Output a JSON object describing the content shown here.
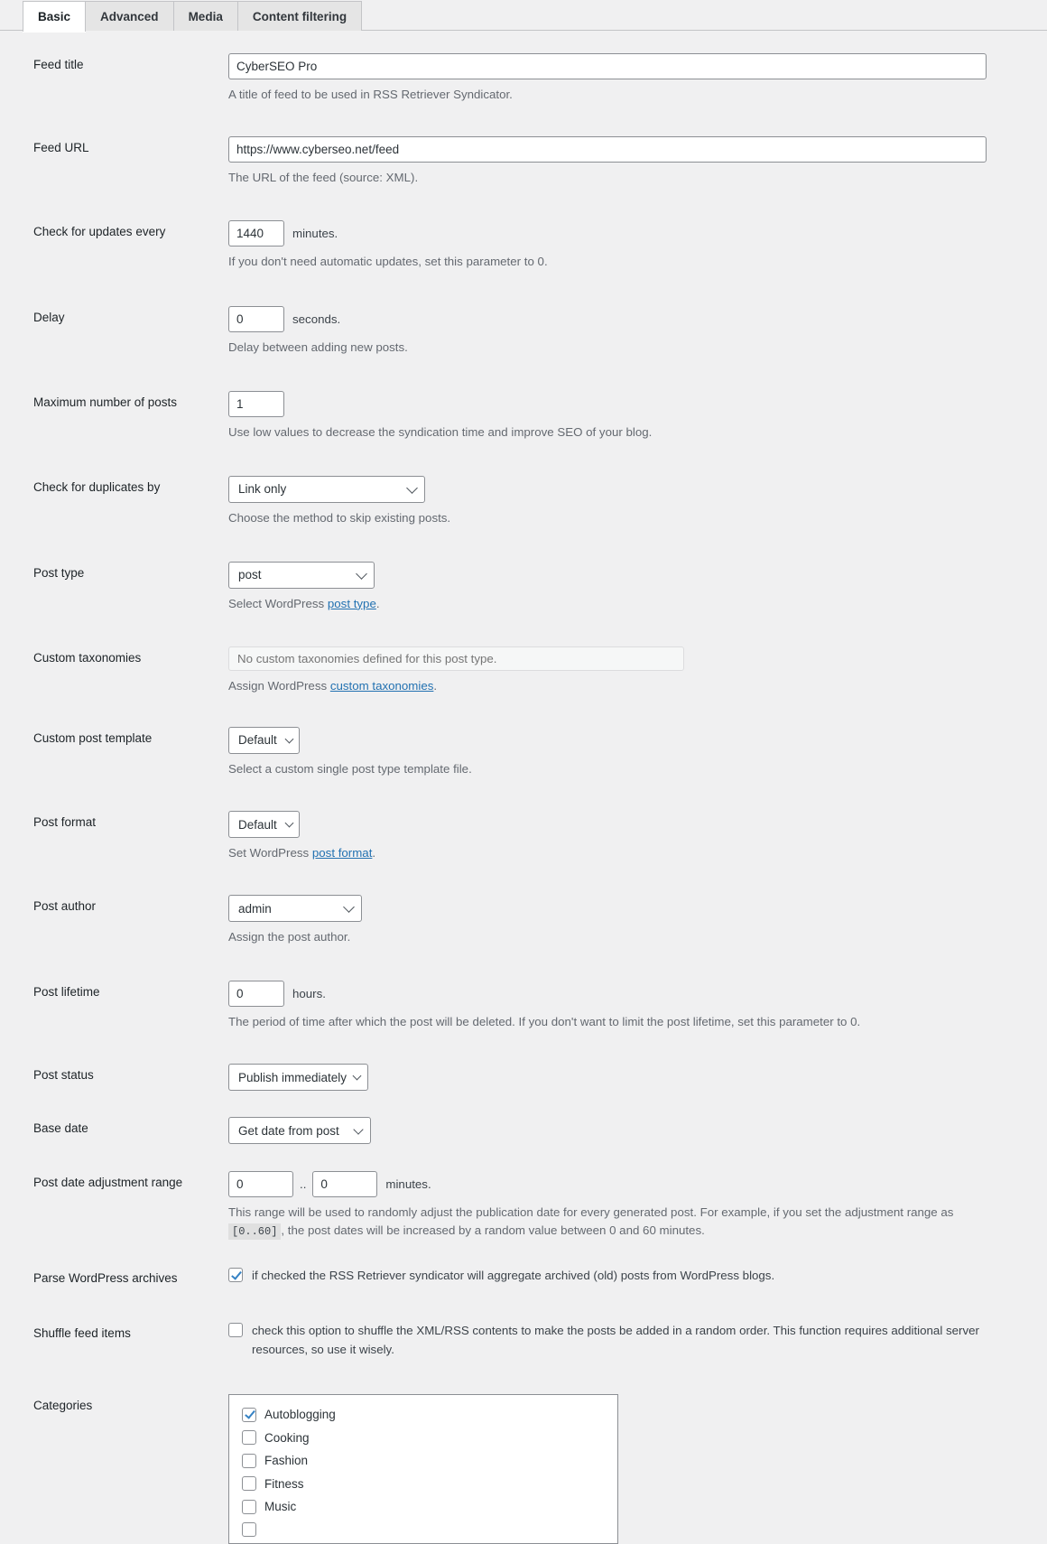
{
  "tabs": [
    {
      "label": "Basic",
      "active": true
    },
    {
      "label": "Advanced",
      "active": false
    },
    {
      "label": "Media",
      "active": false
    },
    {
      "label": "Content filtering",
      "active": false
    }
  ],
  "fields": {
    "feed_title": {
      "label": "Feed title",
      "value": "CyberSEO Pro",
      "description": "A title of feed to be used in RSS Retriever Syndicator."
    },
    "feed_url": {
      "label": "Feed URL",
      "value": "https://www.cyberseo.net/feed",
      "description": "The URL of the feed (source: XML)."
    },
    "check_updates": {
      "label": "Check for updates every",
      "value": "1440",
      "unit": "minutes.",
      "description": "If you don't need automatic updates, set this parameter to 0."
    },
    "delay": {
      "label": "Delay",
      "value": "0",
      "unit": "seconds.",
      "description": "Delay between adding new posts."
    },
    "max_posts": {
      "label": "Maximum number of posts",
      "value": "1",
      "description": "Use low values to decrease the syndication time and improve SEO of your blog."
    },
    "check_duplicates": {
      "label": "Check for duplicates by",
      "value": "Link only",
      "description": "Choose the method to skip existing posts."
    },
    "post_type": {
      "label": "Post type",
      "value": "post",
      "desc_prefix": "Select WordPress ",
      "desc_link": "post type",
      "desc_suffix": "."
    },
    "custom_taxonomies": {
      "label": "Custom taxonomies",
      "placeholder": "No custom taxonomies defined for this post type.",
      "desc_prefix": "Assign WordPress ",
      "desc_link": "custom taxonomies",
      "desc_suffix": "."
    },
    "custom_post_template": {
      "label": "Custom post template",
      "value": "Default",
      "description": "Select a custom single post type template file."
    },
    "post_format": {
      "label": "Post format",
      "value": "Default",
      "desc_prefix": "Set WordPress ",
      "desc_link": "post format",
      "desc_suffix": "."
    },
    "post_author": {
      "label": "Post author",
      "value": "admin",
      "description": "Assign the post author."
    },
    "post_lifetime": {
      "label": "Post lifetime",
      "value": "0",
      "unit": "hours.",
      "description": "The period of time after which the post will be deleted. If you don't want to limit the post lifetime, set this parameter to 0."
    },
    "post_status": {
      "label": "Post status",
      "value": "Publish immediately"
    },
    "base_date": {
      "label": "Base date",
      "value": "Get date from post"
    },
    "post_date_range": {
      "label": "Post date adjustment range",
      "value_from": "0",
      "separator": "..",
      "value_to": "0",
      "unit": "minutes.",
      "desc_part1": "This range will be used to randomly adjust the publication date for every generated post. For example, if you set the adjustment range as",
      "desc_code": "[0..60]",
      "desc_part2": ", the post dates will be increased by a random value between 0 and 60 minutes."
    },
    "parse_archives": {
      "label": "Parse WordPress archives",
      "checked": true,
      "text": "if checked the RSS Retriever syndicator will aggregate archived (old) posts from WordPress blogs."
    },
    "shuffle_feed": {
      "label": "Shuffle feed items",
      "checked": false,
      "text": "check this option to shuffle the XML/RSS contents to make the posts be added in a random order. This function requires additional server resources, so use it wisely."
    },
    "categories": {
      "label": "Categories",
      "items": [
        {
          "label": "Autoblogging",
          "checked": true
        },
        {
          "label": "Cooking",
          "checked": false
        },
        {
          "label": "Fashion",
          "checked": false
        },
        {
          "label": "Fitness",
          "checked": false
        },
        {
          "label": "Music",
          "checked": false
        },
        {
          "label": "",
          "checked": false
        }
      ]
    }
  },
  "colors": {
    "page_bg": "#f0f0f1",
    "link": "#2271b1",
    "checkbox_accent": "#3582c4",
    "label_text": "#1d2327",
    "desc_text": "#646970",
    "input_border": "#8c8f94"
  }
}
